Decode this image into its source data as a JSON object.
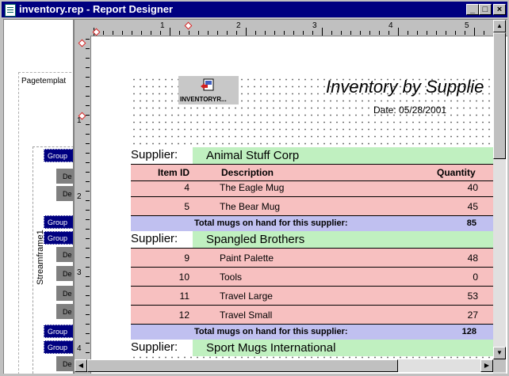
{
  "window": {
    "title": "inventory.rep - Report Designer",
    "controls": {
      "minimize": "_",
      "maximize": "□",
      "close": "×"
    }
  },
  "structure_pane": {
    "page_template_label": "Pagetemplat",
    "stream_frame_label": "Streamframe1",
    "bands": [
      {
        "kind": "group",
        "label": "Group"
      },
      {
        "kind": "detail",
        "label": "De"
      },
      {
        "kind": "detail",
        "label": "De"
      },
      {
        "kind": "group",
        "label": "Group"
      },
      {
        "kind": "group",
        "label": "Group"
      },
      {
        "kind": "detail",
        "label": "De"
      },
      {
        "kind": "detail",
        "label": "De"
      },
      {
        "kind": "detail",
        "label": "De"
      },
      {
        "kind": "detail",
        "label": "De"
      },
      {
        "kind": "group",
        "label": "Group"
      },
      {
        "kind": "group",
        "label": "Group"
      },
      {
        "kind": "detail",
        "label": "De"
      }
    ]
  },
  "rulers": {
    "horizontal": [
      "1",
      "2",
      "3",
      "4",
      "5"
    ],
    "vertical": [
      "1",
      "2",
      "3",
      "4"
    ]
  },
  "report": {
    "logo_caption": "INVENTORYR...",
    "title": "Inventory by Supplie",
    "date": "Date: 05/28/2001",
    "supplier_label": "Supplier:",
    "columns": {
      "item_id": "Item ID",
      "description": "Description",
      "quantity": "Quantity"
    },
    "total_label": "Total mugs on hand for this supplier:",
    "groups": [
      {
        "supplier": "Animal Stuff Corp",
        "rows": [
          {
            "id": "4",
            "description": "The Eagle Mug",
            "quantity": "40"
          },
          {
            "id": "5",
            "description": "The Bear Mug",
            "quantity": "45"
          }
        ],
        "total": "85"
      },
      {
        "supplier": "Spangled Brothers",
        "rows": [
          {
            "id": "9",
            "description": "Paint Palette",
            "quantity": "48"
          },
          {
            "id": "10",
            "description": "Tools",
            "quantity": "0"
          },
          {
            "id": "11",
            "description": "Travel Large",
            "quantity": "53"
          },
          {
            "id": "12",
            "description": "Travel Small",
            "quantity": "27"
          }
        ],
        "total": "128"
      },
      {
        "supplier": "Sport Mugs International",
        "rows": [],
        "total": ""
      }
    ]
  },
  "colors": {
    "title_bar": "#000080",
    "supplier_band": "#c0f0c0",
    "detail_band": "#f7c0c0",
    "total_band": "#c0c0f0"
  },
  "icons": {
    "window_icon": "document-icon",
    "logo_icon": "image-icon"
  }
}
